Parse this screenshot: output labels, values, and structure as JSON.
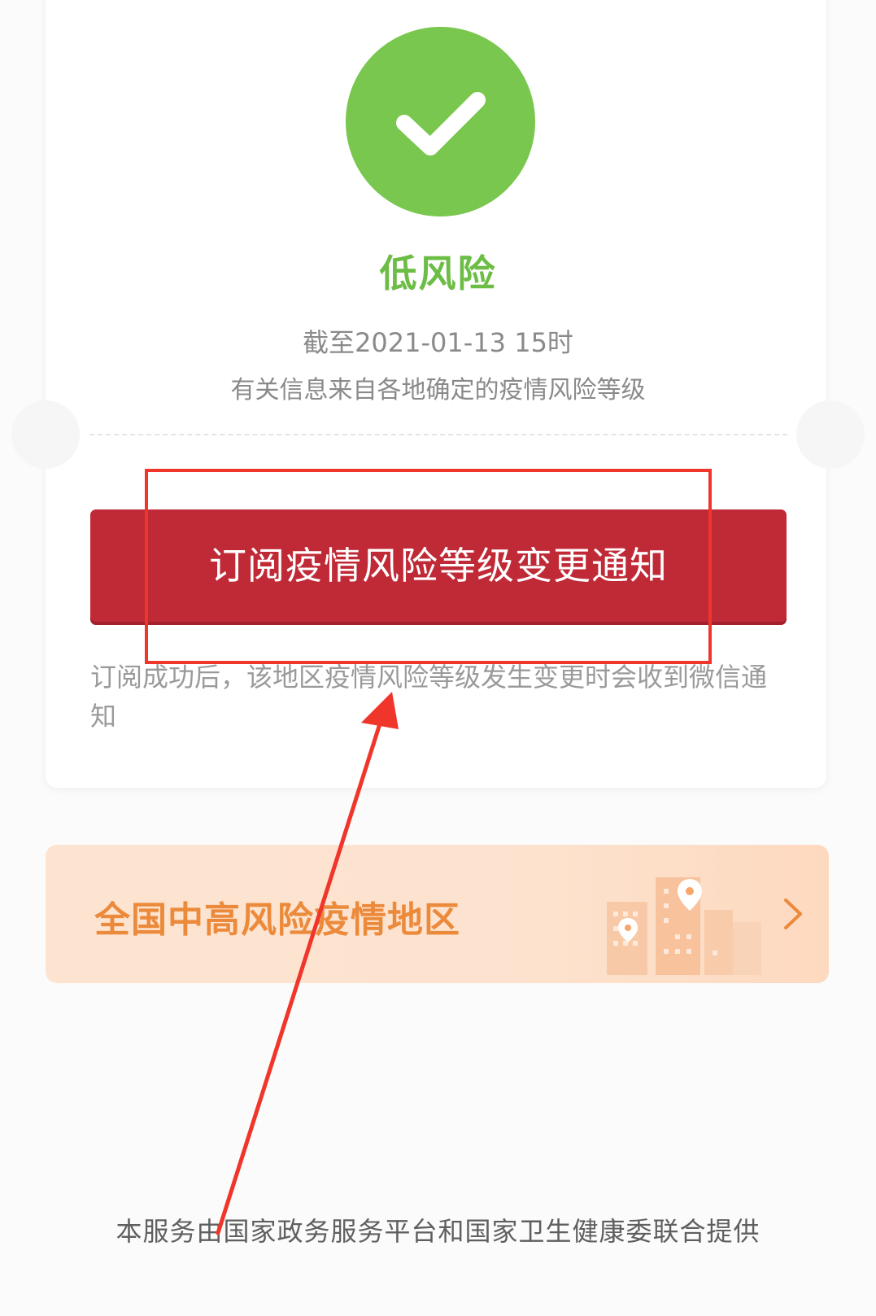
{
  "status": {
    "icon": "check-icon",
    "level": "低风险",
    "as_of": "截至2021-01-13 15时",
    "source_note": "有关信息来自各地确定的疫情风险等级",
    "color": "#79c74e"
  },
  "subscribe": {
    "button_label": "订阅疫情风险等级变更通知",
    "note": "订阅成功后，该地区疫情风险等级发生变更时会收到微信通知",
    "button_color": "#c02a37"
  },
  "regions_banner": {
    "label": "全国中高风险疫情地区",
    "label_color": "#ec8a3c",
    "icons": [
      "buildings-icon",
      "map-pin-icon",
      "chevron-right-icon"
    ]
  },
  "footer": {
    "text": "本服务由国家政务服务平台和国家卫生健康委联合提供"
  },
  "annotation": {
    "color": "#f0352b"
  }
}
